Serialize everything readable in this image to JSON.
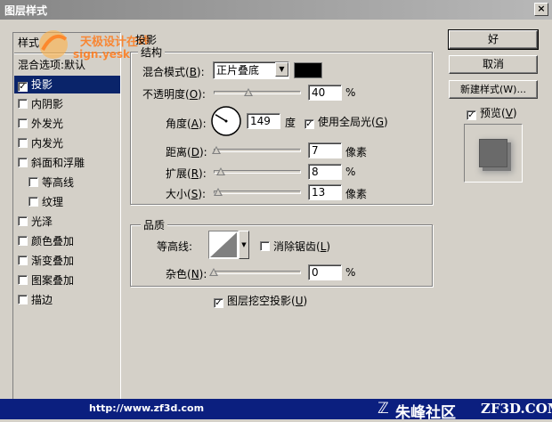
{
  "window": {
    "title": "图层样式",
    "close": "×"
  },
  "watermark": {
    "line1": "天极设计在线",
    "line2": "sign.yesk"
  },
  "sidebar": {
    "header": "样式",
    "items": [
      {
        "label": "混合选项:默认",
        "checkbox": false,
        "checked": false,
        "selected": false
      },
      {
        "label": "投影",
        "checkbox": true,
        "checked": true,
        "selected": true
      },
      {
        "label": "内阴影",
        "checkbox": true,
        "checked": false,
        "selected": false
      },
      {
        "label": "外发光",
        "checkbox": true,
        "checked": false,
        "selected": false
      },
      {
        "label": "内发光",
        "checkbox": true,
        "checked": false,
        "selected": false
      },
      {
        "label": "斜面和浮雕",
        "checkbox": true,
        "checked": false,
        "selected": false
      },
      {
        "label": "等高线",
        "checkbox": true,
        "checked": false,
        "selected": false,
        "indent": true
      },
      {
        "label": "纹理",
        "checkbox": true,
        "checked": false,
        "selected": false,
        "indent": true
      },
      {
        "label": "光泽",
        "checkbox": true,
        "checked": false,
        "selected": false
      },
      {
        "label": "颜色叠加",
        "checkbox": true,
        "checked": false,
        "selected": false
      },
      {
        "label": "渐变叠加",
        "checkbox": true,
        "checked": false,
        "selected": false
      },
      {
        "label": "图案叠加",
        "checkbox": true,
        "checked": false,
        "selected": false
      },
      {
        "label": "描边",
        "checkbox": true,
        "checked": false,
        "selected": false
      }
    ]
  },
  "shadow": {
    "section_title": "投影",
    "structure_title": "结构",
    "blend_label": "混合模式(",
    "blend_key": "B",
    "blend_label_end": "):",
    "blend_value": "正片叠底",
    "blend_color": "#000000",
    "opacity_label": "不透明度(",
    "opacity_key": "O",
    "opacity_label_end": "):",
    "opacity_value": "40",
    "opacity_level": 40,
    "percent": "%",
    "angle_label": "角度(",
    "angle_key": "A",
    "angle_label_end": "):",
    "angle_value": "149",
    "angle_degrees": 149,
    "degree_unit": "度",
    "global_light_label": "使用全局光(",
    "global_light_key": "G",
    "global_light_end": ")",
    "global_light_checked": true,
    "distance_label": "距离(",
    "distance_key": "D",
    "distance_label_end": "):",
    "distance_value": "7",
    "distance_level": 3,
    "spread_label": "扩展(",
    "spread_key": "R",
    "spread_label_end": "):",
    "spread_value": "8",
    "spread_level": 8,
    "size_label": "大小(",
    "size_key": "S",
    "size_label_end": "):",
    "size_value": "13",
    "size_level": 5,
    "pixel_unit": "像素"
  },
  "quality": {
    "title": "品质",
    "contour_label": "等高线:",
    "antialias_label": "消除锯齿(",
    "antialias_key": "L",
    "antialias_end": ")",
    "antialias_checked": false,
    "noise_label": "杂色(",
    "noise_key": "N",
    "noise_label_end": "):",
    "noise_value": "0",
    "noise_level": 0,
    "percent": "%",
    "knockout_label": "图层挖空投影(",
    "knockout_key": "U",
    "knockout_end": ")",
    "knockout_checked": true
  },
  "buttons": {
    "ok": "好",
    "cancel": "取消",
    "new_style": "新建样式(W)...",
    "preview_label": "预览(",
    "preview_key": "V",
    "preview_end": ")",
    "preview_checked": true
  },
  "footer": {
    "url": "http://www.zf3d.com",
    "brand": "朱峰社区",
    "brand_en": "ZF3D.COM"
  }
}
